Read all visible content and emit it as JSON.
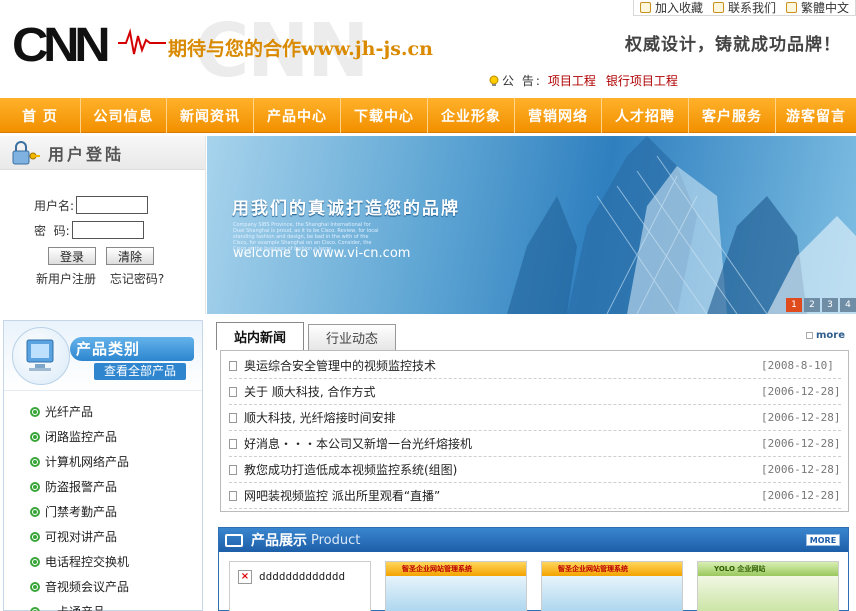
{
  "header": {
    "logo_text": "CNN",
    "logo_watermark": "CNN",
    "slogan": "期待与您的合作www.jh-js.cn",
    "brand_slogan": "权威设计，铸就成功品牌！",
    "top_links": [
      {
        "label": "加入收藏",
        "icon": "favorite-icon"
      },
      {
        "label": "联系我们",
        "icon": "contact-icon"
      },
      {
        "label": "繁體中文",
        "icon": "language-icon"
      }
    ],
    "notice_label": "公 告:",
    "notice_items": [
      "项目工程",
      "银行项目工程"
    ]
  },
  "nav": {
    "items": [
      "首 页",
      "公司信息",
      "新闻资讯",
      "产品中心",
      "下载中心",
      "企业形象",
      "营销网络",
      "人才招聘",
      "客户服务",
      "游客留言"
    ]
  },
  "login": {
    "title": "用户登陆",
    "username_label": "用户名:",
    "password_label": "密  码:",
    "login_button": "登录",
    "clear_button": "清除",
    "register_link": "新用户注册",
    "forgot_link": "忘记密码?"
  },
  "banner": {
    "title": "用我们的真诚打造您的品牌",
    "small_text": "Company SIBS Province, the Shanghai International for Dual Shanghai is proud, as it to be Cisco. Review, for local standing fashion and design, be bad in the with of the Cisco, for example Shanghai on an Cisco. Consider, the Cisco at the business of fashion a large.",
    "welcome": "welcome to www.vi-cn.com",
    "pages": [
      "1",
      "2",
      "3",
      "4"
    ],
    "active_page": "1"
  },
  "categories": {
    "title": "产品类别",
    "view_all": "查看全部产品",
    "items": [
      "光纤产品",
      "闭路监控产品",
      "计算机网络产品",
      "防盗报警产品",
      "门禁考勤产品",
      "可视对讲产品",
      "电话程控交换机",
      "音视频会议产品",
      "一卡通产品"
    ]
  },
  "news": {
    "tabs": [
      "站内新闻",
      "行业动态"
    ],
    "active_tab": "站内新闻",
    "more_label": "more",
    "items": [
      {
        "title": "奥运综合安全管理中的视频监控技术",
        "date": "[2008-8-10]"
      },
      {
        "title": "关于 顺大科技, 合作方式",
        "date": "[2006-12-28]"
      },
      {
        "title": "顺大科技, 光纤熔接时间安排",
        "date": "[2006-12-28]"
      },
      {
        "title": "好消息・・・本公司又新增一台光纤熔接机",
        "date": "[2006-12-28]"
      },
      {
        "title": "教您成功打造低成本视频监控系统(组图)",
        "date": "[2006-12-28]"
      },
      {
        "title": "网吧装视频监控  派出所里观看“直播”",
        "date": "[2006-12-28]"
      }
    ]
  },
  "products": {
    "title": "产品展示",
    "subtitle": "Product",
    "more_label": "MORE",
    "first_item_alt": "ddddddddddddd",
    "thumb_titles": [
      "智圣企业网站管理系统",
      "智圣企业网站管理系统",
      "YOLO 企业网站"
    ]
  },
  "colors": {
    "nav_orange": "#f29000",
    "product_blue": "#1d5ea8",
    "category_green": "#3aa63a",
    "notice_red": "#b00000"
  }
}
